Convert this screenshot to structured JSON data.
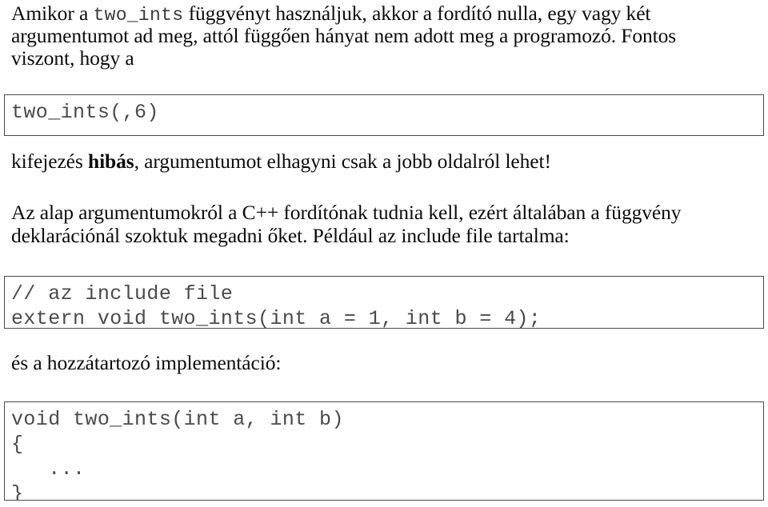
{
  "document": {
    "language": "hu",
    "page_background": "#ffffff",
    "text_color": "#0b0b0b",
    "code_color": "#4a4a4a",
    "code_border_color": "#4a4a4a"
  },
  "paragraph_1": {
    "segments": [
      {
        "type": "text",
        "value": "Amikor a "
      },
      {
        "type": "code",
        "value": "two_ints"
      },
      {
        "type": "text",
        "value": " függvényt használjuk, akkor a fordító nulla, egy vagy két argumentumot ad meg, attól függően hányat nem adott meg a programozó. Fontos viszont, hogy a"
      }
    ],
    "line_1_text": "Amikor a ",
    "line_1_code": "two_ints",
    "line_1_rest": " függvényt használjuk, akkor a fordító nulla, egy vagy két",
    "line_2": "argumentumot ad meg, attól függően hányat nem adott meg a programozó. Fontos",
    "line_3": "viszont, hogy a"
  },
  "code_block_1": {
    "name": "two-ints-call-example",
    "lines": [
      "two_ints(,6)"
    ]
  },
  "paragraph_2": {
    "prefix": "kifejezés ",
    "bold": "hibás",
    "suffix": ", argumentumot elhagyni csak a jobb oldalról lehet!"
  },
  "paragraph_3": {
    "line_1": "Az alap argumentumokról a C++ fordítónak tudnia kell, ezért általában a függvény",
    "line_2": "deklarációnál szoktuk megadni őket. Például az include file tartalma:",
    "full": "Az alap argumentumokról a C++ fordítónak tudnia kell, ezért általában a függvény deklarációnál szoktuk megadni őket. Például az include file tartalma:"
  },
  "code_block_2": {
    "name": "include-file-declaration",
    "lines": [
      "// az include file",
      "extern void two_ints(int a = 1, int b = 4);"
    ]
  },
  "paragraph_4": {
    "text": "és a hozzátartozó implementáció:"
  },
  "code_block_3": {
    "name": "function-implementation",
    "lines": [
      "void two_ints(int a, int b)",
      "{",
      "   ...",
      "}"
    ]
  }
}
